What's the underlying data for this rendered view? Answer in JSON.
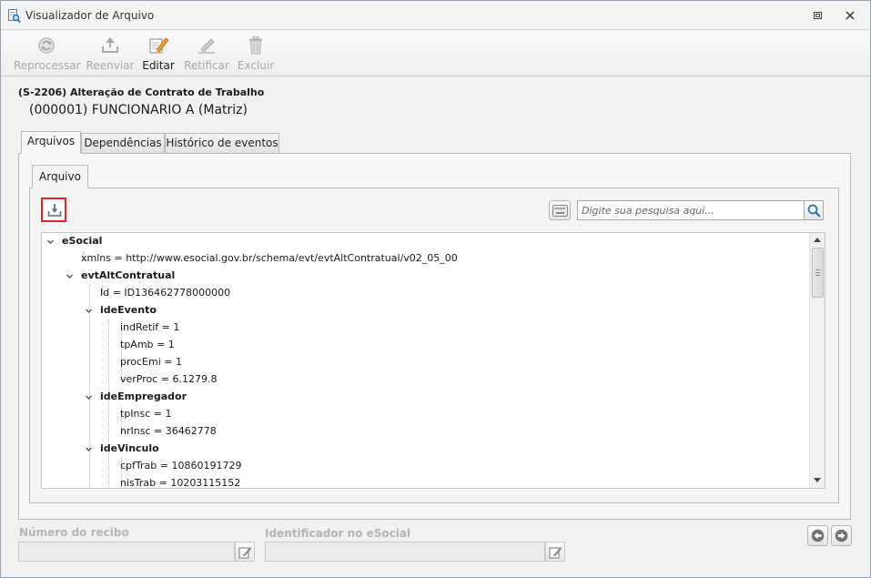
{
  "window": {
    "title": "Visualizador de Arquivo",
    "icon": "document-search-icon"
  },
  "toolbar": {
    "buttons": [
      {
        "label": "Reprocessar",
        "icon": "reprocess-icon",
        "enabled": false
      },
      {
        "label": "Reenviar",
        "icon": "upload-icon",
        "enabled": false
      },
      {
        "label": "Editar",
        "icon": "edit-icon",
        "enabled": true
      },
      {
        "label": "Retificar",
        "icon": "rectify-icon",
        "enabled": false
      },
      {
        "label": "Excluir",
        "icon": "trash-icon",
        "enabled": false
      }
    ]
  },
  "header": {
    "event_title": "(S-2206) Alteração de Contrato de Trabalho",
    "employee": "(000001) FUNCIONARIO A (Matriz)"
  },
  "tabs": [
    {
      "label": "Arquivos",
      "active": true
    },
    {
      "label": "Dependências",
      "active": false
    },
    {
      "label": "Histórico de eventos",
      "active": false
    }
  ],
  "inner_tab": {
    "label": "Arquivo"
  },
  "search": {
    "placeholder": "Digite sua pesquisa aqui..."
  },
  "tree": [
    {
      "text": "eSocial",
      "group": true,
      "expanded": true,
      "level": 0
    },
    {
      "text": "xmlns = http://www.esocial.gov.br/schema/evt/evtAltContratual/v02_05_00",
      "group": false,
      "level": 1
    },
    {
      "text": "evtAltContratual",
      "group": true,
      "expanded": true,
      "level": 1
    },
    {
      "text": "Id = ID136462778000000",
      "group": false,
      "level": 2
    },
    {
      "text": "ideEvento",
      "group": true,
      "expanded": true,
      "level": 2
    },
    {
      "text": "indRetif = 1",
      "group": false,
      "level": 3
    },
    {
      "text": "tpAmb = 1",
      "group": false,
      "level": 3
    },
    {
      "text": "procEmi = 1",
      "group": false,
      "level": 3
    },
    {
      "text": "verProc = 6.1279.8",
      "group": false,
      "level": 3
    },
    {
      "text": "ideEmpregador",
      "group": true,
      "expanded": true,
      "level": 2
    },
    {
      "text": "tpInsc = 1",
      "group": false,
      "level": 3
    },
    {
      "text": "nrInsc = 36462778",
      "group": false,
      "level": 3
    },
    {
      "text": "ideVinculo",
      "group": true,
      "expanded": true,
      "level": 2
    },
    {
      "text": "cpfTrab = 10860191729",
      "group": false,
      "level": 3
    },
    {
      "text": "nisTrab = 10203115152",
      "group": false,
      "level": 3
    }
  ],
  "fields": {
    "receipt_label": "Número do recibo",
    "receipt_value": "",
    "esocial_id_label": "Identificador no eSocial",
    "esocial_id_value": ""
  },
  "colors": {
    "highlight_border": "#e0242c",
    "accent_blue": "#2a6ea8"
  }
}
